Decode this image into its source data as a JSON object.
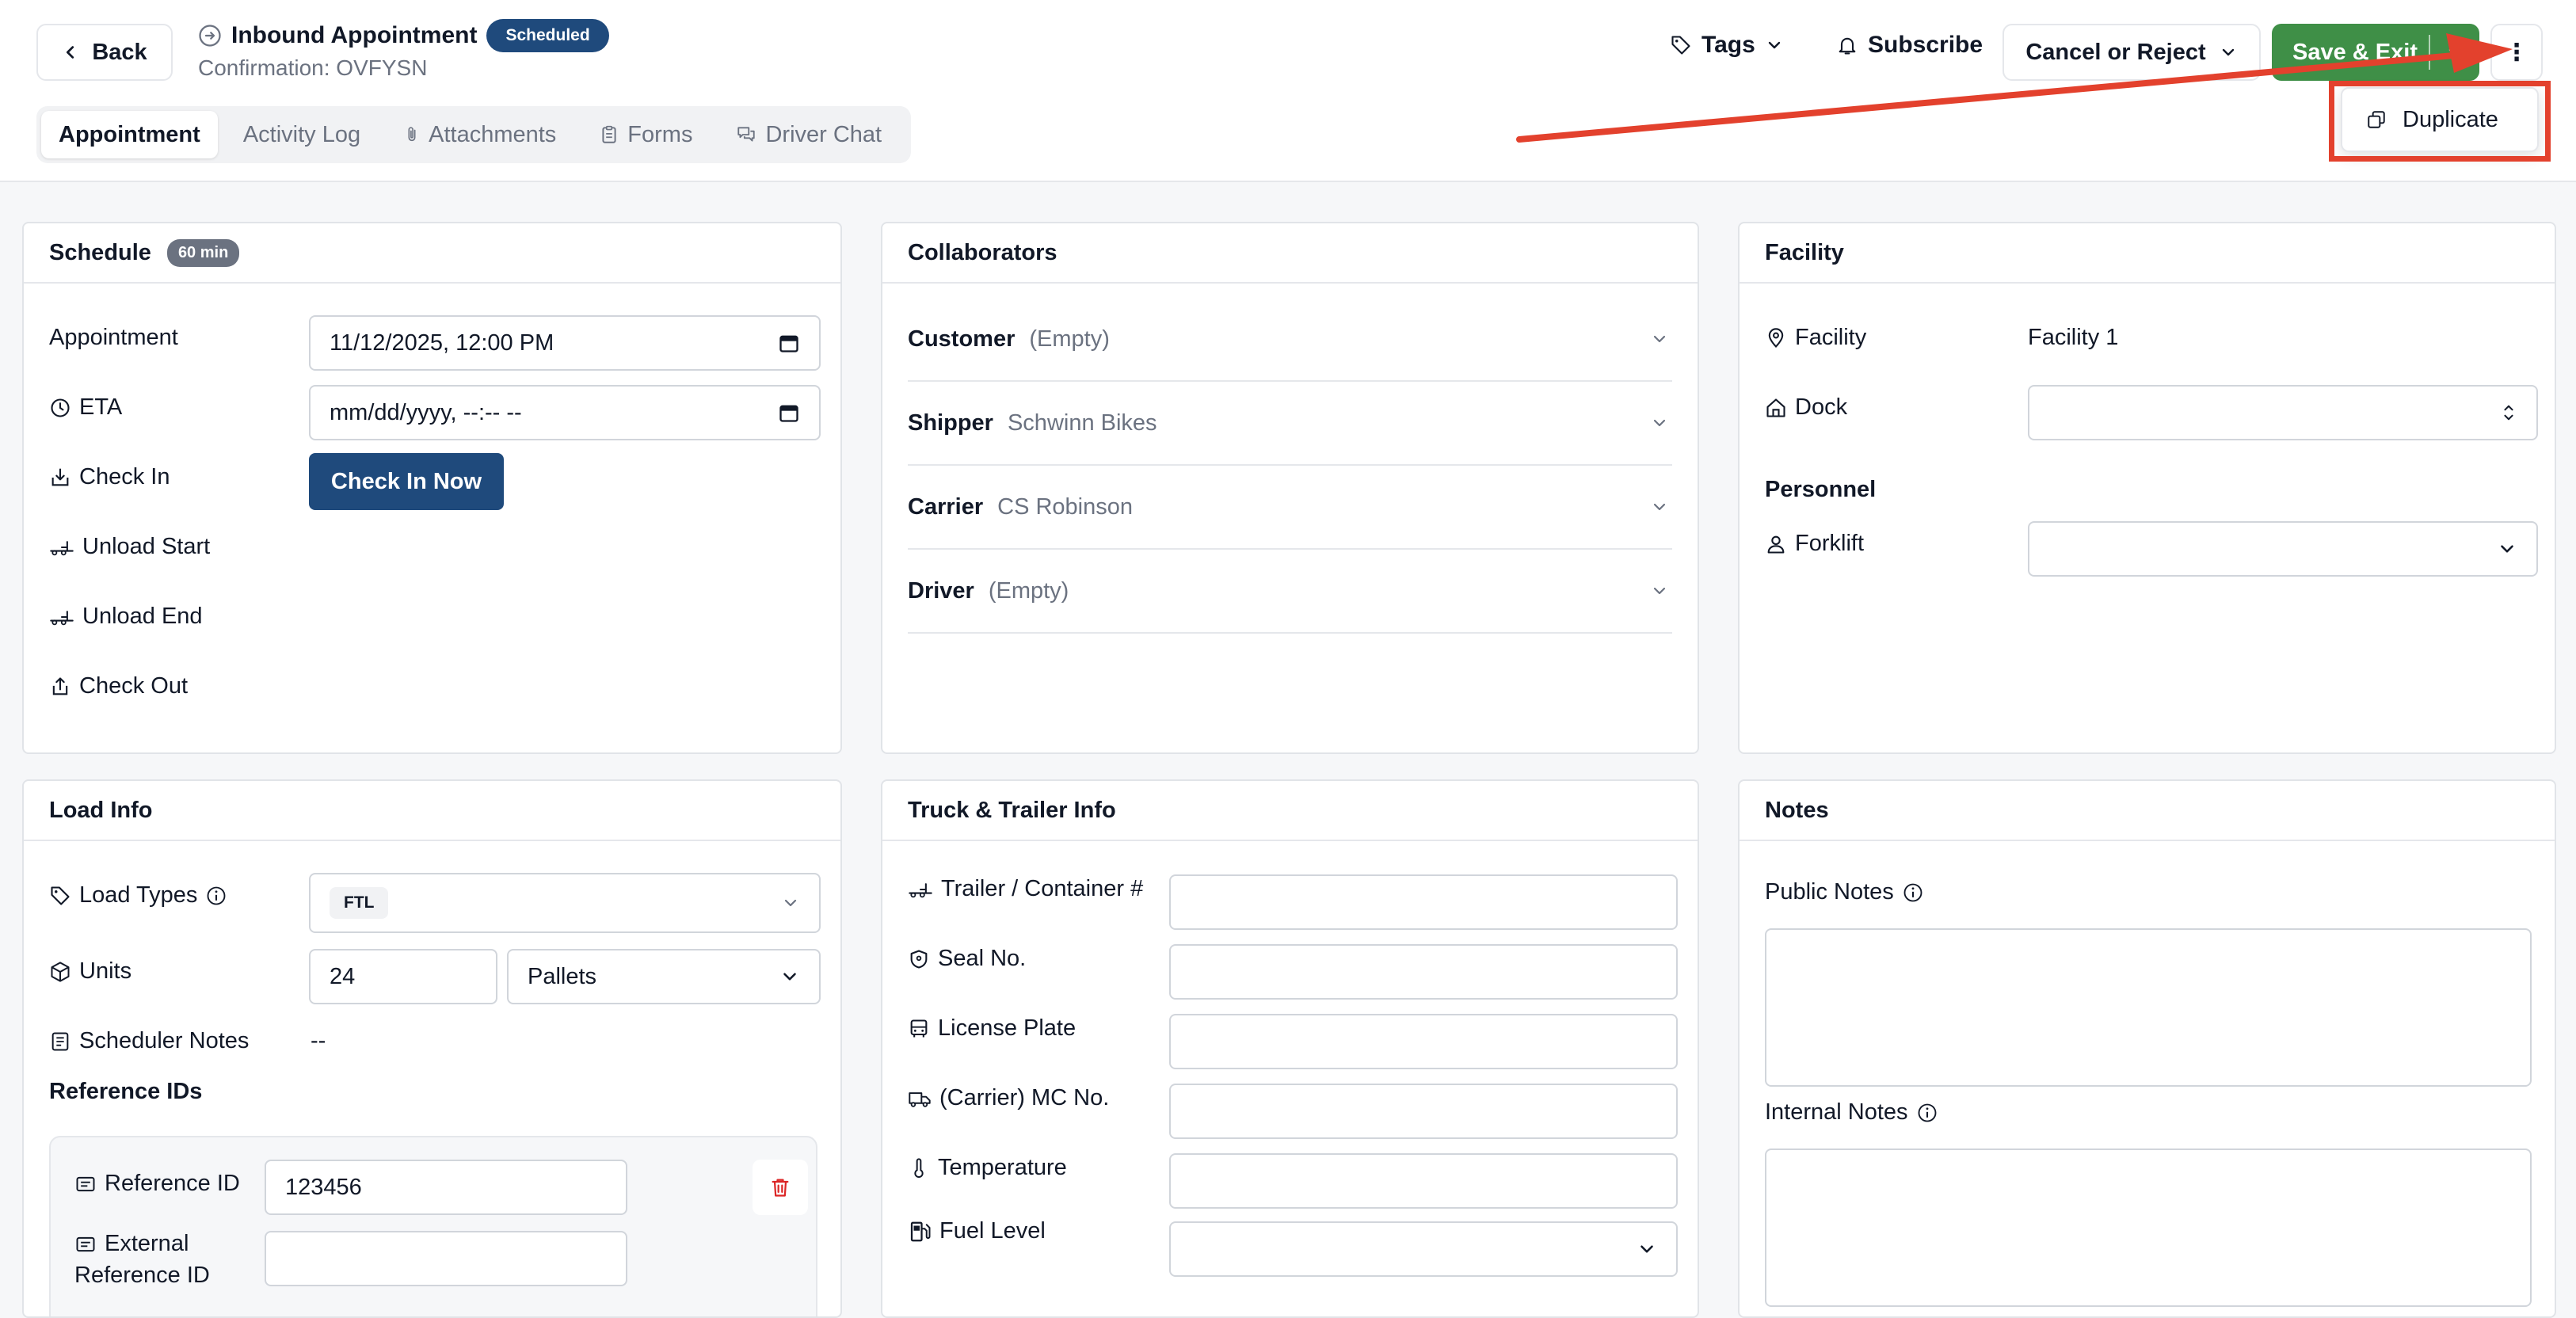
{
  "header": {
    "back_label": "Back",
    "title": "Inbound Appointment",
    "status_badge": "Scheduled",
    "confirmation": "Confirmation: OVFYSN",
    "tabs": [
      {
        "label": "Appointment"
      },
      {
        "label": "Activity Log"
      },
      {
        "label": "Attachments"
      },
      {
        "label": "Forms"
      },
      {
        "label": "Driver Chat"
      }
    ],
    "tags_label": "Tags",
    "subscribe_label": "Subscribe",
    "cancel_label": "Cancel or Reject",
    "save_label": "Save & Exit",
    "more_icon": "⋮",
    "menu": {
      "duplicate_label": "Duplicate"
    }
  },
  "colors": {
    "primary": "#1f4a7c",
    "success": "#3f8f47",
    "annotation": "#e3412d"
  },
  "schedule": {
    "title": "Schedule",
    "duration": "60 min",
    "appointment_label": "Appointment",
    "appointment_value": "11/12/2025, 12:00 PM",
    "eta_label": "ETA",
    "eta_placeholder": "mm/dd/yyyy, --:-- --",
    "checkin_label": "Check In",
    "checkin_button": "Check In Now",
    "unload_start_label": "Unload Start",
    "unload_end_label": "Unload End",
    "checkout_label": "Check Out"
  },
  "collaborators": {
    "title": "Collaborators",
    "rows": [
      {
        "label": "Customer",
        "value": "(Empty)"
      },
      {
        "label": "Shipper",
        "value": "Schwinn Bikes"
      },
      {
        "label": "Carrier",
        "value": "CS Robinson"
      },
      {
        "label": "Driver",
        "value": "(Empty)"
      }
    ]
  },
  "facility": {
    "title": "Facility",
    "facility_label": "Facility",
    "facility_value": "Facility 1",
    "dock_label": "Dock",
    "dock_value": "",
    "personnel_heading": "Personnel",
    "forklift_label": "Forklift",
    "forklift_value": ""
  },
  "load_info": {
    "title": "Load Info",
    "load_types_label": "Load Types",
    "load_type_chip": "FTL",
    "units_label": "Units",
    "units_value": "24",
    "units_type": "Pallets",
    "scheduler_notes_label": "Scheduler Notes",
    "scheduler_notes_value": "--",
    "reference_ids_heading": "Reference IDs",
    "reference_id_label": "Reference ID",
    "reference_id_value": "123456",
    "external_ref_label_1": "External",
    "external_ref_label_2": "Reference ID",
    "external_ref_value": ""
  },
  "truck": {
    "title": "Truck & Trailer Info",
    "trailer_label": "Trailer / Container #",
    "seal_label": "Seal No.",
    "license_label": "License Plate",
    "mc_label": "(Carrier) MC No.",
    "temperature_label": "Temperature",
    "fuel_label": "Fuel Level"
  },
  "notes": {
    "title": "Notes",
    "public_label": "Public Notes",
    "internal_label": "Internal Notes"
  }
}
